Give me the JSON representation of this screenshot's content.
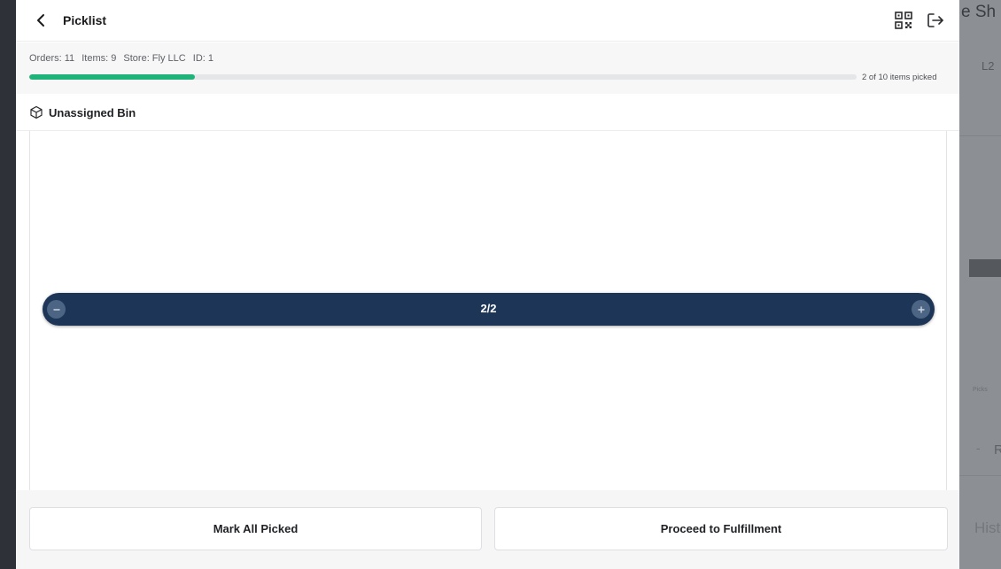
{
  "background_app": {
    "title_fragment": "e Sh",
    "label_fragment": "L2",
    "small_text": "Picks",
    "row_fragment": "R",
    "row_dash": "-",
    "footer_fragment": "Hist"
  },
  "header": {
    "title": "Picklist",
    "icons": [
      "back-chevron-icon",
      "qr-code-icon",
      "logout-icon"
    ]
  },
  "info": {
    "orders": "Orders: 11",
    "items": "Items: 9",
    "store": "Store: Fly LLC",
    "id": "ID: 1",
    "progress_fraction": 0.2,
    "progress_text": "2 of 10 items picked",
    "progress_color": "#1fb37a"
  },
  "bin": {
    "icon": "cube-icon",
    "label": "Unassigned Bin"
  },
  "stepper": {
    "value": "2/2",
    "minus_icon": "minus-icon",
    "plus_icon": "plus-icon",
    "color": "#1d3557"
  },
  "footer": {
    "mark_all_label": "Mark All Picked",
    "proceed_label": "Proceed to Fulfillment"
  }
}
